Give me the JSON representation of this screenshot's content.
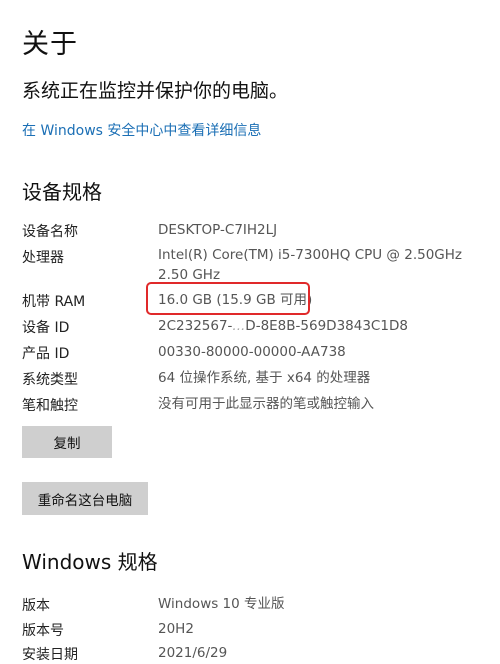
{
  "page": {
    "title": "关于",
    "subtitle": "系统正在监控并保护你的电脑。",
    "security_link": "在 Windows 安全中心中查看详细信息"
  },
  "device_specs": {
    "heading": "设备规格",
    "rows": [
      {
        "label": "设备名称",
        "value": "DESKTOP-C7IH2LJ"
      },
      {
        "label": "处理器",
        "value": "Intel(R) Core(TM) i5-7300HQ CPU @ 2.50GHz",
        "value_line2": "2.50 GHz"
      },
      {
        "label": "机带 RAM",
        "value": "16.0 GB (15.9 GB 可用)"
      },
      {
        "label": "设备 ID",
        "value_start": "2C232567-",
        "value_obscured": "...",
        "value_end": "D-8E8B-569D3843C1D8"
      },
      {
        "label": "产品 ID",
        "value": "00330-80000-00000-AA738"
      },
      {
        "label": "系统类型",
        "value": "64 位操作系统, 基于 x64 的处理器"
      },
      {
        "label": "笔和触控",
        "value": "没有可用于此显示器的笔或触控输入"
      }
    ],
    "copy_button": "复制",
    "rename_button": "重命名这台电脑"
  },
  "windows_specs": {
    "heading": "Windows 规格",
    "rows": [
      {
        "label": "版本",
        "value": "Windows 10 专业版"
      },
      {
        "label": "版本号",
        "value": "20H2"
      },
      {
        "label": "安装日期",
        "value": "2021/6/29"
      }
    ]
  },
  "colors": {
    "link": "#1b6fb5",
    "highlight_box": "#e0292a",
    "button_bg": "#cfcfcf"
  }
}
